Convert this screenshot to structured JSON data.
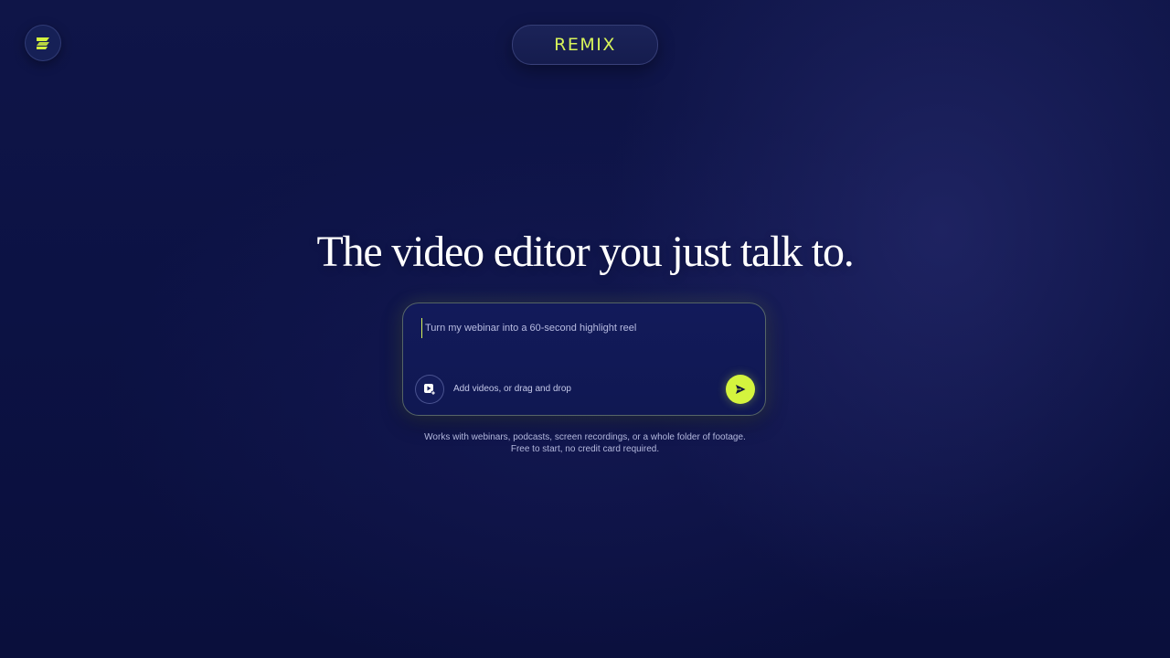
{
  "brand": {
    "logo_icon": "remix-logo-icon",
    "name": "REMIX",
    "accent_color": "#d4f43e"
  },
  "hero": {
    "headline": "The video editor you just talk to."
  },
  "prompt": {
    "placeholder": "Turn my webinar into a 60-second highlight reel",
    "value": "",
    "upload_icon": "video-add-icon",
    "upload_label": "Add videos, or drag and drop",
    "send_icon": "send-arrow-icon"
  },
  "footnote": {
    "line1": "Works with webinars, podcasts, screen recordings, or a whole folder of footage.",
    "line2": "Free to start, no credit card required."
  }
}
